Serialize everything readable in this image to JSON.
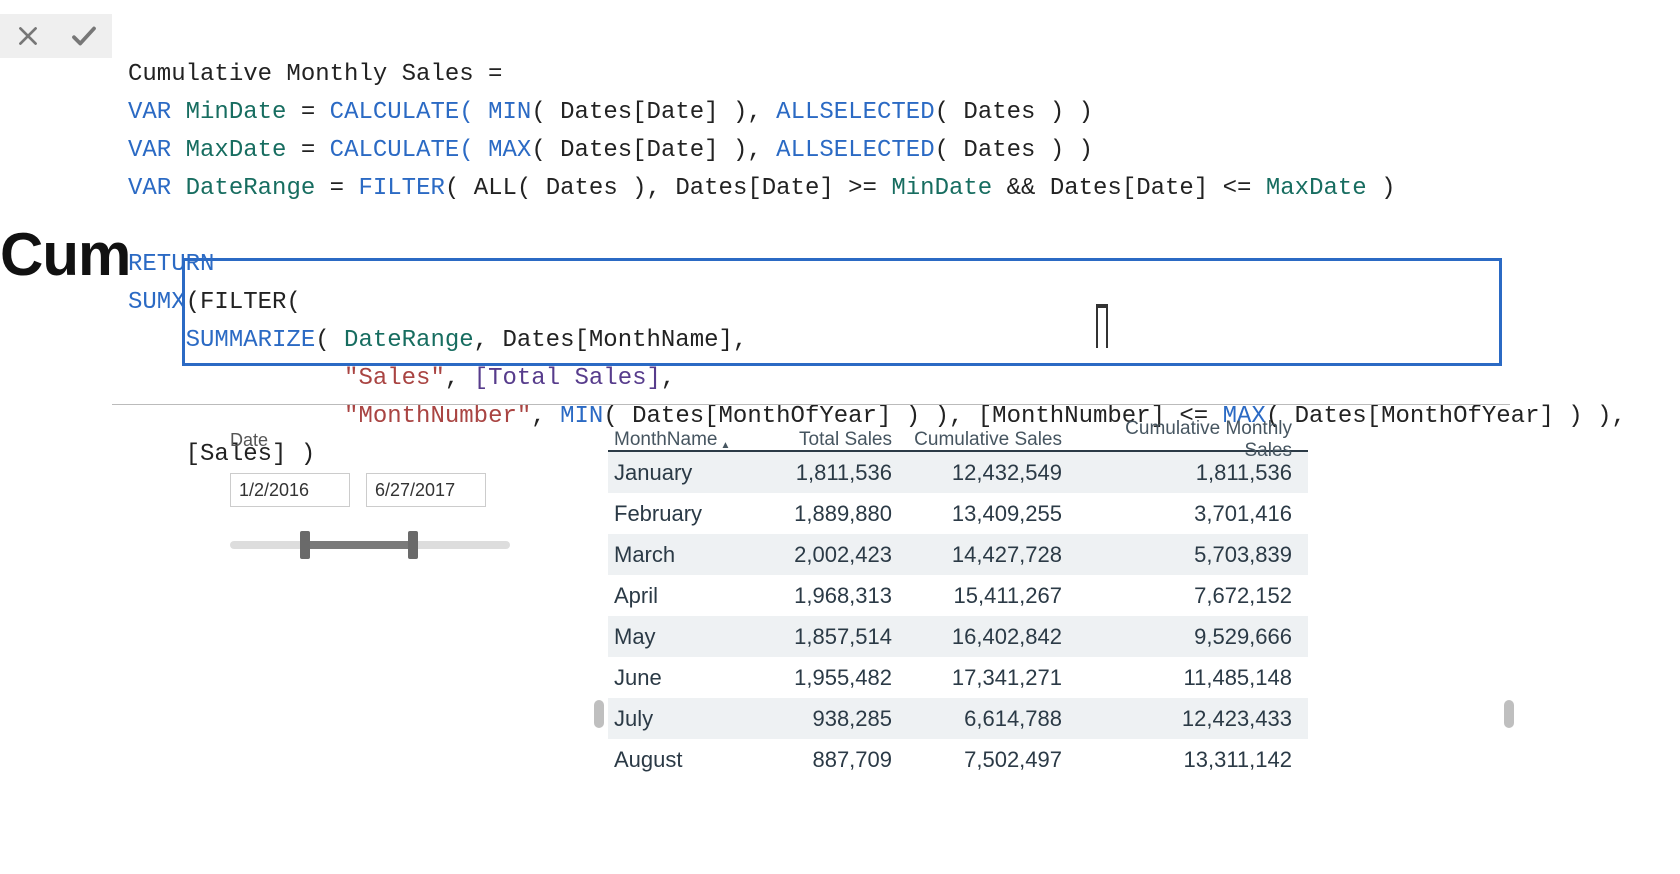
{
  "toolbar": {
    "cancel_icon": "close-icon",
    "commit_icon": "check-icon"
  },
  "title_fragment": "Cum",
  "dax": {
    "line1_plain": "Cumulative Monthly Sales =",
    "var_kw": "VAR",
    "min_var": "MinDate",
    "max_var": "MaxDate",
    "range_var": "DateRange",
    "eq": " = ",
    "calc_open": "CALCULATE( ",
    "min_fn": "MIN",
    "max_fn": "MAX",
    "dates_date": "( Dates[Date] ), ",
    "allsel": "ALLSELECTED",
    "dates_close": "( Dates ) )",
    "filter_fn": "FILTER",
    "all_dates": "( ALL( Dates ), Dates[Date] >= ",
    "and": " && Dates[Date] <= ",
    "close1": " )",
    "return_kw": "RETURN",
    "sumx": "SUMX",
    "sumx_open": "(FILTER(",
    "summarize": "SUMMARIZE",
    "summarize_args": "( ",
    "summarize_tail": ", Dates[MonthName],",
    "str_sales": "\"Sales\"",
    "total_sales_ref": "[Total Sales]",
    "comma": ", ",
    "comma2": ",",
    "str_monthnum": "\"MonthNumber\"",
    "min2": "MIN",
    "monthofyear": "( Dates[MonthOfYear] ) ), [MonthNumber] ",
    "lte": "<= ",
    "max2": "MAX",
    "monthofyear2": "( Dates[MonthOfYear] ) ),",
    "sales_close": "[Sales] )"
  },
  "slicer": {
    "label": "Date",
    "from": "1/2/2016",
    "to": "6/27/2017"
  },
  "table": {
    "columns": [
      "MonthName",
      "Total Sales",
      "Cumulative Sales",
      "Cumulative Monthly Sales"
    ],
    "rows": [
      {
        "month": "January",
        "total": "1,811,536",
        "cum": "12,432,549",
        "cmon": "1,811,536"
      },
      {
        "month": "February",
        "total": "1,889,880",
        "cum": "13,409,255",
        "cmon": "3,701,416"
      },
      {
        "month": "March",
        "total": "2,002,423",
        "cum": "14,427,728",
        "cmon": "5,703,839"
      },
      {
        "month": "April",
        "total": "1,968,313",
        "cum": "15,411,267",
        "cmon": "7,672,152"
      },
      {
        "month": "May",
        "total": "1,857,514",
        "cum": "16,402,842",
        "cmon": "9,529,666"
      },
      {
        "month": "June",
        "total": "1,955,482",
        "cum": "17,341,271",
        "cmon": "11,485,148"
      },
      {
        "month": "July",
        "total": "938,285",
        "cum": "6,614,788",
        "cmon": "12,423,433"
      },
      {
        "month": "August",
        "total": "887,709",
        "cum": "7,502,497",
        "cmon": "13,311,142"
      }
    ]
  },
  "chart_data": {
    "type": "table",
    "title": "Cumulative Monthly Sales",
    "columns": [
      "MonthName",
      "Total Sales",
      "Cumulative Sales",
      "Cumulative Monthly Sales"
    ],
    "rows": [
      [
        "January",
        1811536,
        12432549,
        1811536
      ],
      [
        "February",
        1889880,
        13409255,
        3701416
      ],
      [
        "March",
        2002423,
        14427728,
        5703839
      ],
      [
        "April",
        1968313,
        15411267,
        7672152
      ],
      [
        "May",
        1857514,
        16402842,
        9529666
      ],
      [
        "June",
        1955482,
        17341271,
        11485148
      ],
      [
        "July",
        938285,
        6614788,
        12423433
      ],
      [
        "August",
        887709,
        7502497,
        13311142
      ]
    ]
  }
}
